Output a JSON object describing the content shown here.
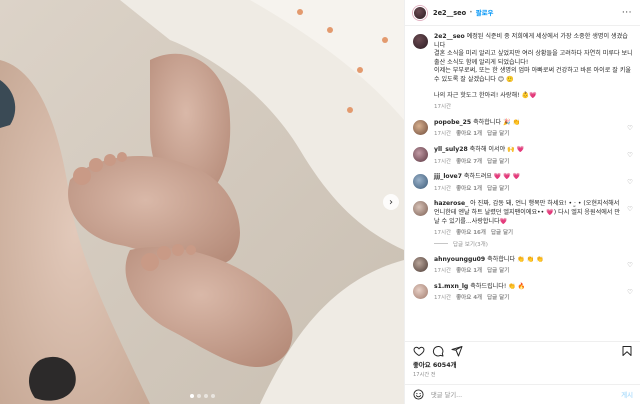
{
  "header": {
    "username": "2e2__seo",
    "separator": "•",
    "follow_label": "팔로우",
    "more_label": "···"
  },
  "caption": {
    "username": "2e2__seo",
    "text": " 예정된 식준비 중 저희에게 세상에서 가장 소중한 생명이 생겼습니다\n결혼 소식을 미리 알리고 싶었지만 여러 상황들을 고려하다 자연히 미루다 보니 출산 소식도 함께 알리게 되었습니다!\n이제는 부부로써, 또는 한 생명의 엄마 아빠로써 건강하고 바른 아이로 잘 키울 수 있도록 잘 살겠습니다 😊 🙂",
    "text2": "나의 자근 핫도그 한아리! 사랑해! 👶💗",
    "time": "17시간"
  },
  "comments": [
    {
      "username": "popobe_25",
      "text": "축하합니다 🎉 👏",
      "time": "17시간",
      "likes": "좋아요 1개",
      "reply": "답글 달기"
    },
    {
      "username": "yll_suly28",
      "text": "축하해 이서야 🙌 💗",
      "time": "17시간",
      "likes": "좋아요 7개",
      "reply": "답글 달기"
    },
    {
      "username": "jjj_love7",
      "text": "축하드려요 💗 💗 💗",
      "time": "17시간",
      "likes": "좋아요 1개",
      "reply": "답글 달기"
    },
    {
      "username": "hazerose",
      "text": "_ 아 진짜, 감동 돼, 언니 행복만 하세요! • ·̫ • (오현지석해서 언니한테 엔날 하트 날렸던 엘지팬이에요•• 💗) 다시 엘지 응원석에서 만날 수 있기를...사랑합니다💗",
      "time": "17시간",
      "likes": "좋아요 16개",
      "reply": "답글 달기",
      "replies": "답글 보기(3개)"
    },
    {
      "username": "ahnyounggu09",
      "text": "축하합니다 👏 👏 👏",
      "time": "17시간",
      "likes": "좋아요 1개",
      "reply": "답글 달기"
    },
    {
      "username": "s1.mxn_lg",
      "text": "축하드립니다! 👏 🔥",
      "time": "17시간",
      "likes": "좋아요 4개",
      "reply": "답글 달기"
    }
  ],
  "footer": {
    "likes": "좋아요 6054개",
    "date": "17시간 전",
    "comment_placeholder": "댓글 달기...",
    "post_label": "게시"
  },
  "carousel": {
    "slides": 4,
    "active": 0
  },
  "colors": {
    "accent": "#0095f6",
    "muted": "#8e8e8e",
    "heart": "#ed4956"
  },
  "icons": [
    "more-icon",
    "heart-icon",
    "comment-icon",
    "share-icon",
    "bookmark-icon",
    "smile-icon",
    "chevron-right-icon"
  ]
}
